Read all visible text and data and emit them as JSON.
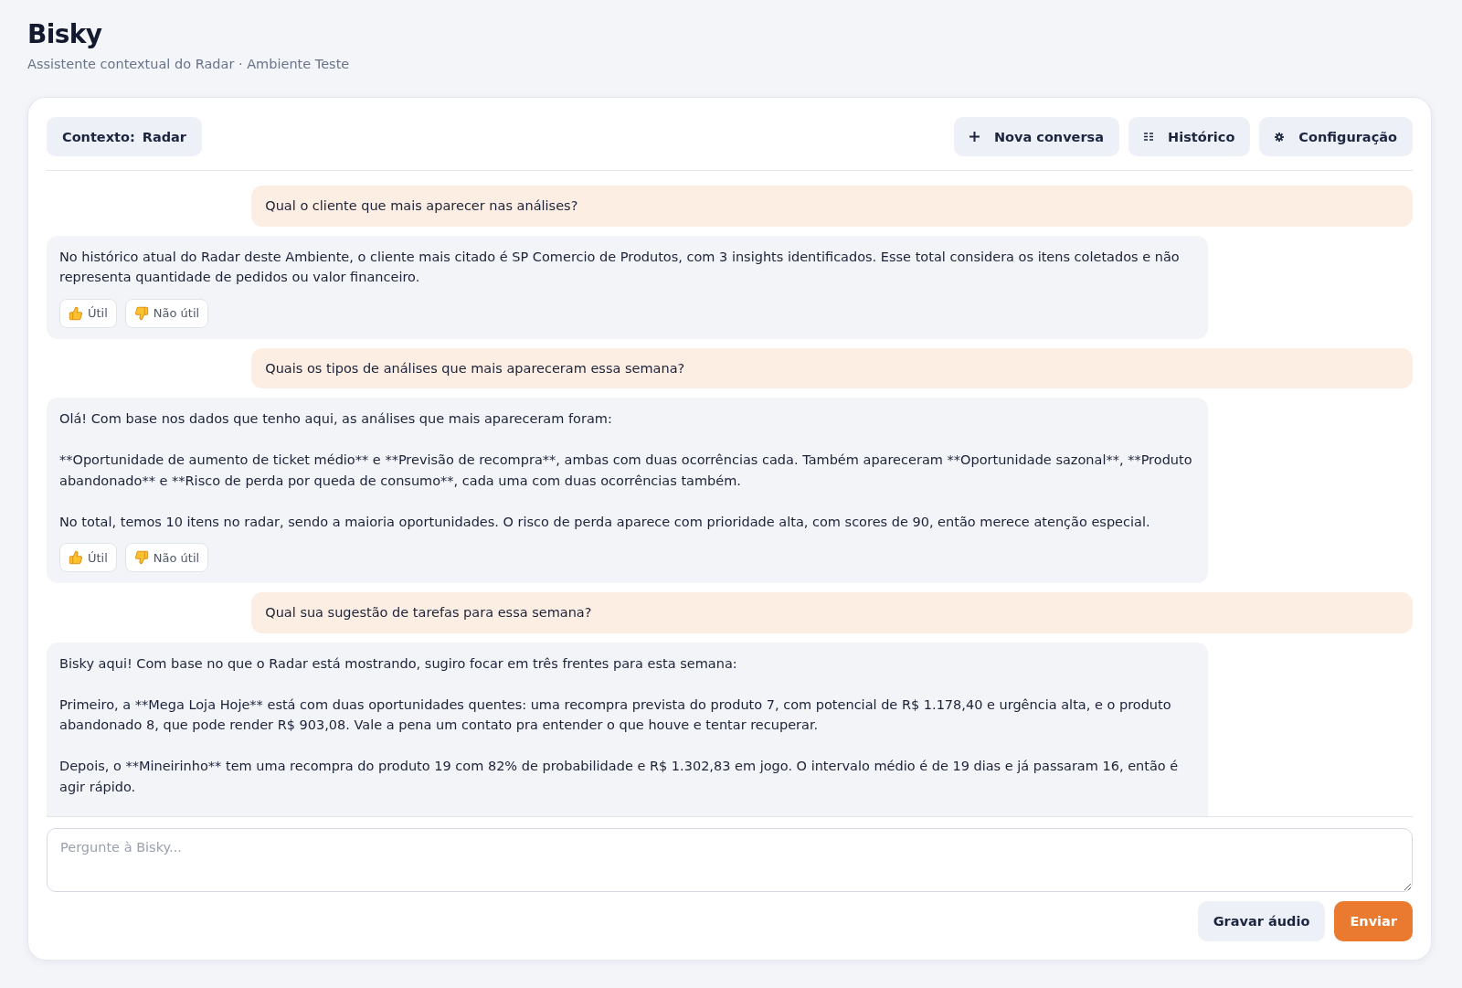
{
  "header": {
    "title": "Bisky",
    "subtitle": "Assistente contextual do Radar · Ambiente Teste"
  },
  "toolbar": {
    "context": {
      "label": "Contexto:",
      "value": "Radar"
    },
    "actions": [
      {
        "kind": "new",
        "label": "Nova conversa"
      },
      {
        "kind": "history",
        "label": "Histórico"
      },
      {
        "kind": "settings",
        "label": "Configuração"
      }
    ]
  },
  "messages": [
    {
      "kind": "user",
      "text": "Qual o cliente que mais aparecer nas análises?"
    },
    {
      "kind": "assistant",
      "text": "No histórico atual do Radar deste Ambiente, o cliente mais citado é SP Comercio de Produtos, com 3 insights identificados. Esse total considera os itens coletados e não representa quantidade de pedidos ou valor financeiro.",
      "feedback": [
        {
          "kind": "up",
          "label": "Útil"
        },
        {
          "kind": "down",
          "label": "Não útil"
        }
      ]
    },
    {
      "kind": "user",
      "text": "Quais os tipos de análises que mais apareceram essa semana?"
    },
    {
      "kind": "assistant",
      "text": "Olá! Com base nos dados que tenho aqui, as análises que mais apareceram foram:\n\n**Oportunidade de aumento de ticket médio** e **Previsão de recompra**, ambas com duas ocorrências cada. Também apareceram **Oportunidade sazonal**, **Produto abandonado** e **Risco de perda por queda de consumo**, cada uma com duas ocorrências também.\n\nNo total, temos 10 itens no radar, sendo a maioria oportunidades. O risco de perda aparece com prioridade alta, com scores de 90, então merece atenção especial.",
      "feedback": [
        {
          "kind": "up",
          "label": "Útil"
        },
        {
          "kind": "down",
          "label": "Não útil"
        }
      ]
    },
    {
      "kind": "user",
      "text": "Qual sua sugestão de tarefas para essa semana?"
    },
    {
      "kind": "assistant",
      "text": "Bisky aqui! Com base no que o Radar está mostrando, sugiro focar em três frentes para esta semana:\n\nPrimeiro, a **Mega Loja Hoje** está com duas oportunidades quentes: uma recompra prevista do produto 7, com potencial de R$ 1.178,40 e urgência alta, e o produto abandonado 8, que pode render R$ 903,08. Vale a pena um contato pra entender o que houve e tentar recuperar.\n\nDepois, o **Mineirinho** tem uma recompra do produto 19 com 82% de probabilidade e R$ 1.302,83 em jogo. O intervalo médio é de 19 dias e já passaram 16, então é agir rápido."
    }
  ],
  "composer": {
    "placeholder": "Pergunte à Bisky...",
    "buttons": [
      {
        "kind": "record",
        "label": "Gravar áudio"
      },
      {
        "kind": "send",
        "label": "Enviar"
      }
    ]
  }
}
